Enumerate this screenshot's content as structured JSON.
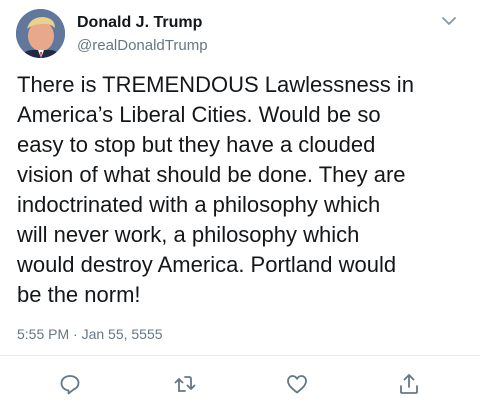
{
  "author": {
    "display_name": "Donald J. Trump",
    "handle": "@realDonaldTrump",
    "avatar_icon": "profile-photo"
  },
  "tweet": {
    "text": "There is TREMENDOUS Lawlessness in\nAmerica’s Liberal Cities. Would be so\neasy to stop but they have a clouded\nvision of what should be done. They are\nindoctrinated with a philosophy which\nwill never work, a philosophy which\nwould destroy America. Portland would\nbe the norm!",
    "timestamp": "5:55 PM · Jan 55, 5555"
  },
  "actions": {
    "reply_icon": "reply-icon",
    "retweet_icon": "retweet-icon",
    "like_icon": "heart-icon",
    "share_icon": "share-icon"
  },
  "colors": {
    "text": "#14171a",
    "secondary": "#657786",
    "divider": "#e6ecf0",
    "icon": "#657786"
  }
}
